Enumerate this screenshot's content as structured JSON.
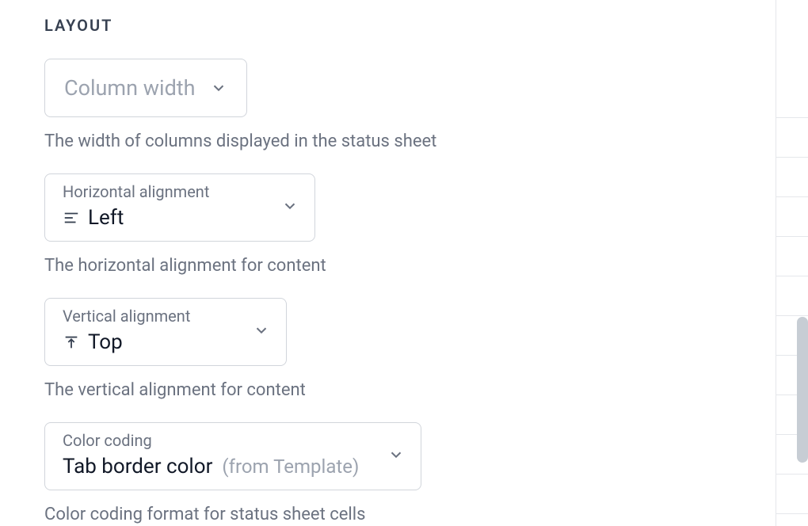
{
  "section": {
    "title": "LAYOUT"
  },
  "fields": {
    "column_width": {
      "placeholder": "Column width",
      "description": "The width of columns displayed in the status sheet"
    },
    "horizontal_alignment": {
      "label": "Horizontal alignment",
      "value": "Left",
      "description": "The horizontal alignment for content"
    },
    "vertical_alignment": {
      "label": "Vertical alignment",
      "value": "Top",
      "description": "The vertical alignment for content"
    },
    "color_coding": {
      "label": "Color coding",
      "value": "Tab border color",
      "suffix": "(from Template)",
      "description": "Color coding format for status sheet cells"
    }
  }
}
